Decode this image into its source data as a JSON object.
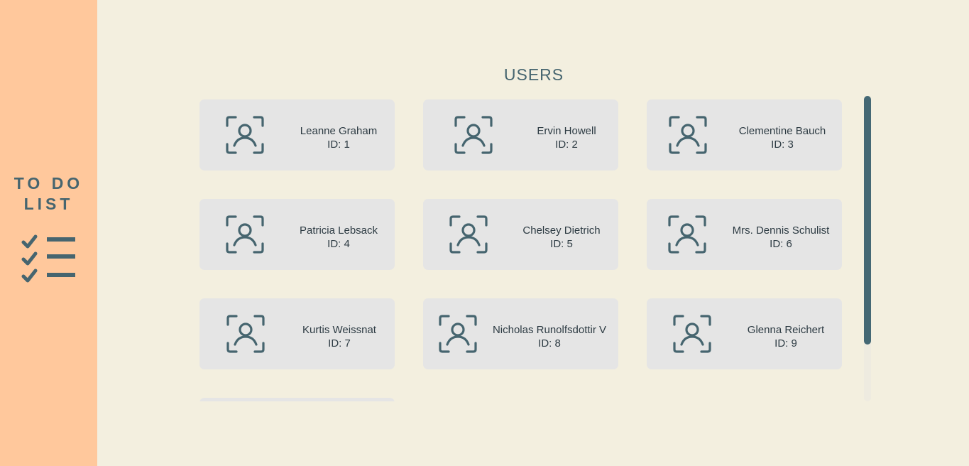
{
  "sidebar": {
    "brand_line1": "TO DO",
    "brand_line2": "LIST",
    "brand_icon": "checklist-icon"
  },
  "main": {
    "title": "USERS"
  },
  "users": [
    {
      "name": "Leanne Graham",
      "id_text": "ID: 1"
    },
    {
      "name": "Ervin Howell",
      "id_text": "ID: 2"
    },
    {
      "name": "Clementine Bauch",
      "id_text": "ID: 3"
    },
    {
      "name": "Patricia Lebsack",
      "id_text": "ID: 4"
    },
    {
      "name": "Chelsey Dietrich",
      "id_text": "ID: 5"
    },
    {
      "name": "Mrs. Dennis Schulist",
      "id_text": "ID: 6"
    },
    {
      "name": "Kurtis Weissnat",
      "id_text": "ID: 7"
    },
    {
      "name": "Nicholas Runolfsdottir V",
      "id_text": "ID: 8"
    },
    {
      "name": "Glenna Reichert",
      "id_text": "ID: 9"
    },
    {
      "name": "",
      "id_text": ""
    }
  ],
  "colors": {
    "sidebar_bg": "#ffc89c",
    "page_bg": "#f3efdf",
    "card_bg": "#e5e5e5",
    "accent": "#446874"
  },
  "icons": {
    "user_avatar": "user-scan-icon"
  }
}
